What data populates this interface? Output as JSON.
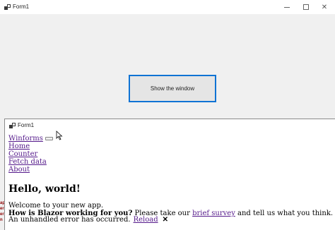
{
  "outer_window": {
    "title": "Form1",
    "controls": {
      "minimize": "",
      "maximize": "",
      "close": "✕"
    },
    "button_label": "Show the window",
    "left_fragment": "ap\ner\ner\nn"
  },
  "inner_window": {
    "title": "Form1",
    "nav": {
      "brand": "Winforms",
      "links": [
        "Home",
        "Counter",
        "Fetch data",
        "About"
      ]
    },
    "heading": "Hello, world!",
    "welcome": "Welcome to your new app.",
    "survey": {
      "question": "How is Blazor working for you?",
      "before_link": " Please take our ",
      "link": "brief survey",
      "after_link": " and tell us what you think."
    },
    "error": {
      "message": "An unhandled error has occurred.",
      "reload": "Reload",
      "dismiss": "✕"
    }
  },
  "colors": {
    "accent_border": "#0f73d4",
    "link": "#551a8b"
  }
}
